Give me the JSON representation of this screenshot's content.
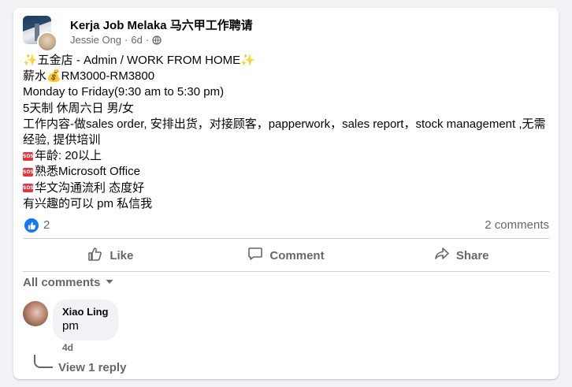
{
  "post": {
    "group_name": "Kerja Job Melaka 马六甲工作聘请",
    "author": "Jessie Ong",
    "separator": "·",
    "time": "6d",
    "privacy_icon": "globe-icon",
    "lines": [
      "✨五金店 - Admin / WORK FROM HOME✨",
      "薪水💰RM3000-RM3800",
      "Monday to Friday(9:30 am to 5:30 pm)",
      "5天制  休周六日  男/女",
      "工作内容-做sales order, 安排出货，对接顾客，papperwork，sales report，stock management ,无需经验, 提供培训",
      "年龄: 20以上",
      "熟悉Microsoft Office",
      "华文沟通流利 态度好",
      "有兴趣的可以 pm 私信我"
    ],
    "sos_label": "SOS",
    "reaction_icon": "thumbs-up-icon",
    "reaction_count": "2",
    "comment_count": "2 comments"
  },
  "actions": {
    "like": "Like",
    "comment": "Comment",
    "share": "Share"
  },
  "comments": {
    "filter_label": "All comments",
    "items": [
      {
        "author": "Xiao Ling",
        "text": "pm",
        "time": "4d",
        "replies_label": "View 1 reply"
      }
    ]
  },
  "colors": {
    "page_bg": "#f0f2f5",
    "card_bg": "#ffffff",
    "secondary_text": "#65676b",
    "like_blue": "#1877f2",
    "sos_red": "#e4343d"
  }
}
